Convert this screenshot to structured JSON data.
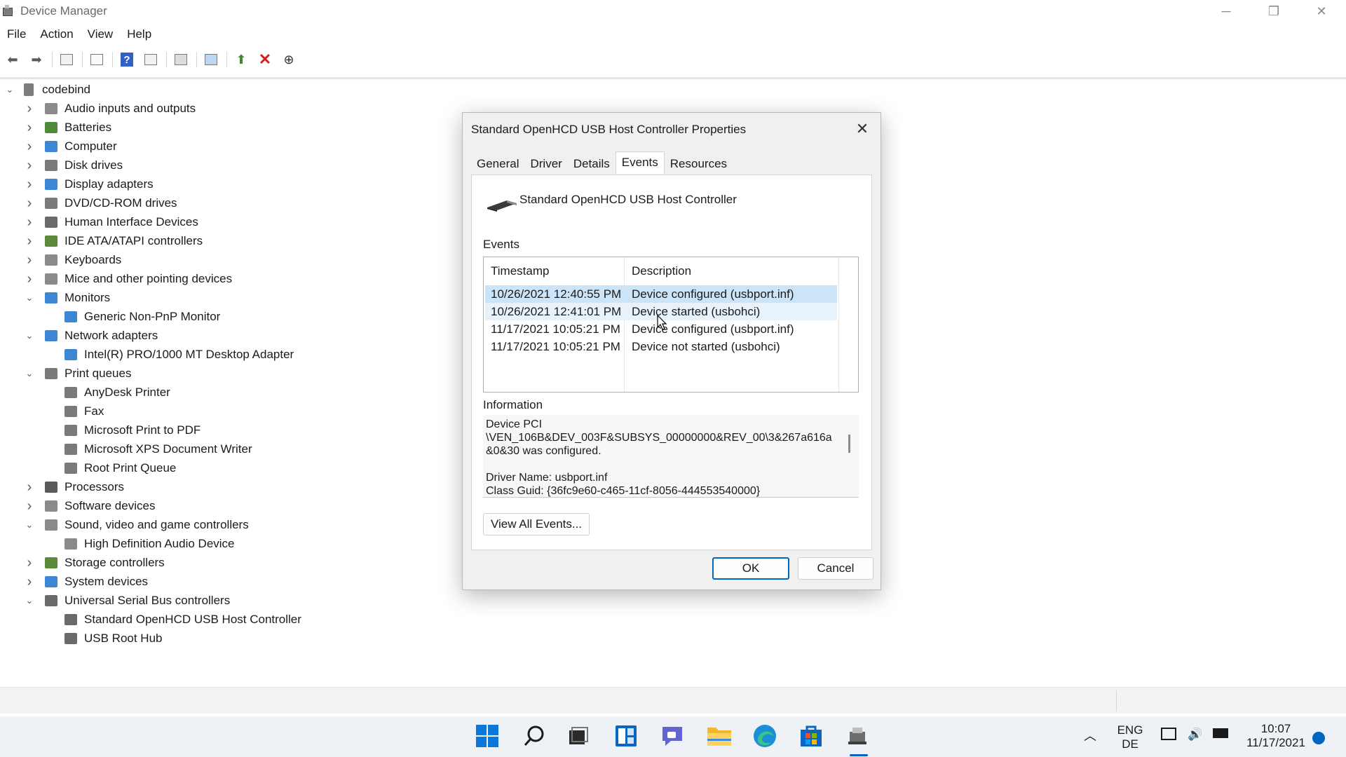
{
  "window": {
    "title": "Device Manager",
    "controls": {
      "minimize": "─",
      "maximize": "❐",
      "close": "✕"
    }
  },
  "menu": [
    "File",
    "Action",
    "View",
    "Help"
  ],
  "tree": {
    "root": "codebind",
    "items": [
      {
        "label": "Audio inputs and outputs",
        "icon": "speaker-icon",
        "color": "#8a8a8a"
      },
      {
        "label": "Batteries",
        "icon": "battery-icon",
        "color": "#4f8a3a"
      },
      {
        "label": "Computer",
        "icon": "monitor-icon",
        "color": "#3d86d6"
      },
      {
        "label": "Disk drives",
        "icon": "disk-icon",
        "color": "#7a7a7a"
      },
      {
        "label": "Display adapters",
        "icon": "display-adapter-icon",
        "color": "#3d86d6"
      },
      {
        "label": "DVD/CD-ROM drives",
        "icon": "optical-drive-icon",
        "color": "#7a7a7a"
      },
      {
        "label": "Human Interface Devices",
        "icon": "hid-icon",
        "color": "#6a6a6a"
      },
      {
        "label": "IDE ATA/ATAPI controllers",
        "icon": "ide-controller-icon",
        "color": "#5b8a3a"
      },
      {
        "label": "Keyboards",
        "icon": "keyboard-icon",
        "color": "#8a8a8a"
      },
      {
        "label": "Mice and other pointing devices",
        "icon": "mouse-icon",
        "color": "#8a8a8a"
      },
      {
        "label": "Monitors",
        "icon": "monitor-icon",
        "color": "#3d86d6"
      },
      {
        "label": "Generic Non-PnP Monitor",
        "icon": "monitor-icon",
        "color": "#3d86d6"
      },
      {
        "label": "Network adapters",
        "icon": "network-adapter-icon",
        "color": "#3d86d6"
      },
      {
        "label": "Intel(R) PRO/1000 MT Desktop Adapter",
        "icon": "network-adapter-icon",
        "color": "#3d86d6"
      },
      {
        "label": "Print queues",
        "icon": "printer-icon",
        "color": "#7a7a7a"
      },
      {
        "label": "AnyDesk Printer",
        "icon": "printer-icon",
        "color": "#7a7a7a"
      },
      {
        "label": "Fax",
        "icon": "printer-icon",
        "color": "#7a7a7a"
      },
      {
        "label": "Microsoft Print to PDF",
        "icon": "printer-icon",
        "color": "#7a7a7a"
      },
      {
        "label": "Microsoft XPS Document Writer",
        "icon": "printer-icon",
        "color": "#7a7a7a"
      },
      {
        "label": "Root Print Queue",
        "icon": "printer-icon",
        "color": "#7a7a7a"
      },
      {
        "label": "Processors",
        "icon": "processor-icon",
        "color": "#5a5a5a"
      },
      {
        "label": "Software devices",
        "icon": "software-device-icon",
        "color": "#8a8a8a"
      },
      {
        "label": "Sound, video and game controllers",
        "icon": "speaker-icon",
        "color": "#8a8a8a"
      },
      {
        "label": "High Definition Audio Device",
        "icon": "speaker-icon",
        "color": "#8a8a8a"
      },
      {
        "label": "Storage controllers",
        "icon": "storage-controller-icon",
        "color": "#5b8a3a"
      },
      {
        "label": "System devices",
        "icon": "system-device-icon",
        "color": "#3d86d6"
      },
      {
        "label": "Universal Serial Bus controllers",
        "icon": "usb-icon",
        "color": "#6a6a6a"
      },
      {
        "label": "Standard OpenHCD USB Host Controller",
        "icon": "usb-icon",
        "color": "#6a6a6a"
      },
      {
        "label": "USB Root Hub",
        "icon": "usb-icon",
        "color": "#6a6a6a"
      }
    ]
  },
  "dialog": {
    "title": "Standard OpenHCD USB Host Controller Properties",
    "tabs": [
      "General",
      "Driver",
      "Details",
      "Events",
      "Resources"
    ],
    "active_tab": "Events",
    "device_name": "Standard OpenHCD USB Host Controller",
    "events_label": "Events",
    "columns": [
      "Timestamp",
      "Description"
    ],
    "events": [
      {
        "timestamp": "10/26/2021 12:40:55 PM",
        "description": "Device configured (usbport.inf)"
      },
      {
        "timestamp": "10/26/2021 12:41:01 PM",
        "description": "Device started (usbohci)"
      },
      {
        "timestamp": "11/17/2021 10:05:21 PM",
        "description": "Device configured (usbport.inf)"
      },
      {
        "timestamp": "11/17/2021 10:05:21 PM",
        "description": "Device not started (usbohci)"
      }
    ],
    "information_label": "Information",
    "information_text": "Device PCI\n\\VEN_106B&DEV_003F&SUBSYS_00000000&REV_00\\3&267a616a\n&0&30 was configured.\n\nDriver Name: usbport.inf\nClass Guid: {36fc9e60-c465-11cf-8056-444553540000}",
    "view_all_button": "View All Events...",
    "ok_button": "OK",
    "cancel_button": "Cancel",
    "accent_color": "#0067c0",
    "selection_color": "#cce4f7"
  },
  "taskbar": {
    "language_line1": "ENG",
    "language_line2": "DE",
    "time": "10:07",
    "date": "11/17/2021"
  }
}
